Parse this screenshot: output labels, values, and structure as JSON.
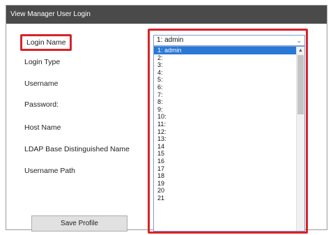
{
  "window": {
    "title": "View Manager User Login"
  },
  "form": {
    "labels": [
      {
        "id": "login-type",
        "text": "Login Type"
      },
      {
        "id": "username",
        "text": "Username"
      },
      {
        "id": "password",
        "text": "Password:"
      },
      {
        "id": "host-name",
        "text": "Host Name"
      },
      {
        "id": "ldap-base-dn",
        "text": "LDAP Base Distinguished Name"
      },
      {
        "id": "username-path",
        "text": "Username Path"
      }
    ],
    "login_name_label": "Login Name",
    "save_button_label": "Save Profile"
  },
  "login_name_select": {
    "selected_value": "1: admin",
    "options": [
      "1: admin",
      "2:",
      "3:",
      "4:",
      "5:",
      "6:",
      "7:",
      "8:",
      "9:",
      "10:",
      "11:",
      "12:",
      "13:",
      "14",
      "15",
      "16",
      "17",
      "18",
      "19",
      "20",
      "21"
    ],
    "highlighted_index": 0
  },
  "icons": {
    "select_chevron": "chevron-down-icon",
    "scroll_up": "scroll-up-arrow-icon"
  },
  "colors": {
    "highlight_red": "#d92228",
    "selection_blue": "#2a78d6",
    "titlebar": "#4a4a4a"
  }
}
